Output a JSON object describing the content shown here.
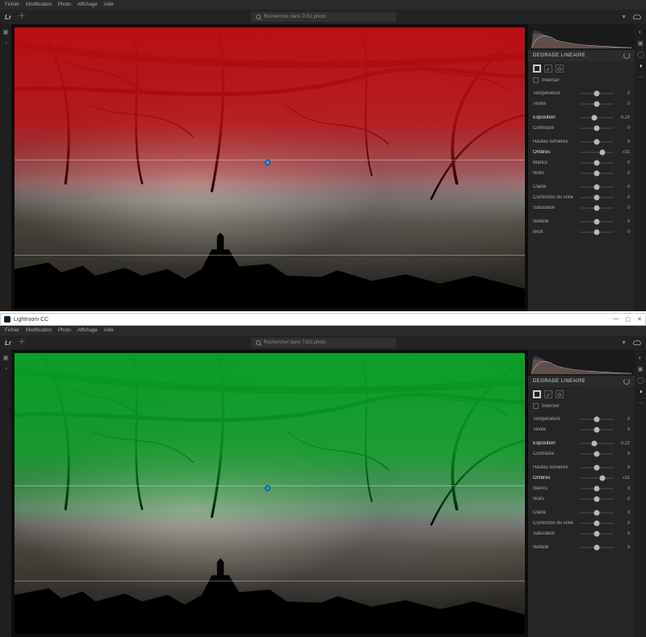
{
  "apps": [
    {
      "overlay_color": "red",
      "menubar": [
        "Fichier",
        "Modification",
        "Photo",
        "Affichage",
        "Aide"
      ],
      "search_placeholder": "Rechercher dans 7x52.photo",
      "panel": {
        "title": "DEGRADE LINEAIRE",
        "invert_label": "Inverser",
        "sliders": [
          {
            "label": "Température",
            "value": "0",
            "pos": 50,
            "hl": false,
            "gap": false
          },
          {
            "label": "Teinte",
            "value": "0",
            "pos": 50,
            "hl": false,
            "gap": false
          },
          {
            "label": "Exposition",
            "value": "-0,22",
            "pos": 44,
            "hl": true,
            "gap": true
          },
          {
            "label": "Contraste",
            "value": "0",
            "pos": 50,
            "hl": false,
            "gap": false
          },
          {
            "label": "Hautes lumières",
            "value": "0",
            "pos": 50,
            "hl": false,
            "gap": true
          },
          {
            "label": "Ombres",
            "value": "+31",
            "pos": 66,
            "hl": true,
            "gap": false
          },
          {
            "label": "Blancs",
            "value": "0",
            "pos": 50,
            "hl": false,
            "gap": false
          },
          {
            "label": "Noirs",
            "value": "0",
            "pos": 50,
            "hl": false,
            "gap": false
          },
          {
            "label": "Clarté",
            "value": "0",
            "pos": 50,
            "hl": false,
            "gap": true
          },
          {
            "label": "Correction du voile",
            "value": "0",
            "pos": 50,
            "hl": false,
            "gap": false
          },
          {
            "label": "Saturation",
            "value": "0",
            "pos": 50,
            "hl": false,
            "gap": false
          },
          {
            "label": "Netteté",
            "value": "0",
            "pos": 50,
            "hl": false,
            "gap": true
          },
          {
            "label": "Bruit",
            "value": "0",
            "pos": 50,
            "hl": false,
            "gap": false
          }
        ]
      }
    },
    {
      "overlay_color": "green",
      "titlebar": {
        "app_name": "Lightroom CC"
      },
      "menubar": [
        "Fichier",
        "Modification",
        "Photo",
        "Affichage",
        "Aide"
      ],
      "search_placeholder": "Rechercher dans 7x52.photo",
      "panel": {
        "title": "DEGRADE LINEAIRE",
        "invert_label": "Inverser",
        "sliders": [
          {
            "label": "Température",
            "value": "0",
            "pos": 50,
            "hl": false,
            "gap": false
          },
          {
            "label": "Teinte",
            "value": "0",
            "pos": 50,
            "hl": false,
            "gap": false
          },
          {
            "label": "Exposition",
            "value": "-0,22",
            "pos": 44,
            "hl": true,
            "gap": true
          },
          {
            "label": "Contraste",
            "value": "0",
            "pos": 50,
            "hl": false,
            "gap": false
          },
          {
            "label": "Hautes lumières",
            "value": "0",
            "pos": 50,
            "hl": false,
            "gap": true
          },
          {
            "label": "Ombres",
            "value": "+31",
            "pos": 66,
            "hl": true,
            "gap": false
          },
          {
            "label": "Blancs",
            "value": "0",
            "pos": 50,
            "hl": false,
            "gap": false
          },
          {
            "label": "Noirs",
            "value": "0",
            "pos": 50,
            "hl": false,
            "gap": false
          },
          {
            "label": "Clarté",
            "value": "0",
            "pos": 50,
            "hl": false,
            "gap": true
          },
          {
            "label": "Correction du voile",
            "value": "0",
            "pos": 50,
            "hl": false,
            "gap": false
          },
          {
            "label": "Saturation",
            "value": "0",
            "pos": 50,
            "hl": false,
            "gap": false
          },
          {
            "label": "Netteté",
            "value": "0",
            "pos": 50,
            "hl": false,
            "gap": true
          }
        ]
      }
    }
  ]
}
